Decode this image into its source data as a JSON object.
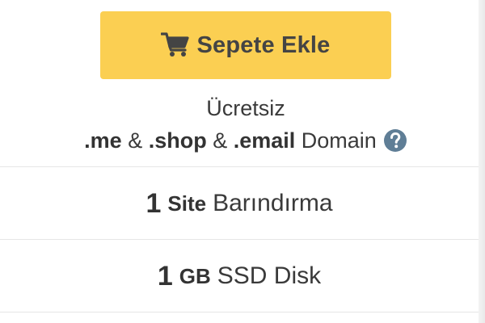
{
  "cart_button": {
    "label": "Sepete Ekle",
    "icon": "shopping-cart-icon",
    "color": "#fbcf52"
  },
  "domain_offer": {
    "free_label": "Ücretsiz",
    "ext1": ".me",
    "sep1": " & ",
    "ext2": ".shop",
    "sep2": " & ",
    "ext3": ".email",
    "suffix": " Domain",
    "help_icon": "question-circle-icon",
    "help_icon_color": "#5f7e96"
  },
  "features": [
    {
      "number": "1",
      "unit": "Site",
      "label": "Barındırma"
    },
    {
      "number": "1",
      "unit": "GB",
      "label": "SSD Disk"
    }
  ]
}
